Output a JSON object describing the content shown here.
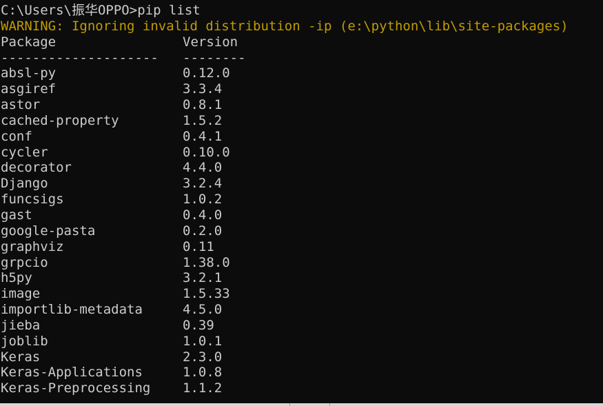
{
  "terminal": {
    "prompt_line": "C:\\Users\\振华OPPO>pip list",
    "prompt_path": "C:\\Users\\",
    "prompt_user_cjk": "振华",
    "prompt_user_rest": "OPPO",
    "prompt_symbol": ">",
    "command": "pip list",
    "warning_line": "WARNING: Ignoring invalid distribution -ip (e:\\python\\lib\\site-packages)",
    "blank_line": "",
    "colors": {
      "background": "#0c0c0c",
      "foreground": "#cccccc",
      "warning": "#c19c00",
      "chrome": "#d6d6d6"
    }
  },
  "table": {
    "headers": {
      "package": "Package",
      "version": "Version"
    },
    "separators": {
      "package": "--------------------",
      "version": "--------"
    },
    "rows": [
      {
        "package": "absl-py",
        "version": "0.12.0"
      },
      {
        "package": "asgiref",
        "version": "3.3.4"
      },
      {
        "package": "astor",
        "version": "0.8.1"
      },
      {
        "package": "cached-property",
        "version": "1.5.2"
      },
      {
        "package": "conf",
        "version": "0.4.1"
      },
      {
        "package": "cycler",
        "version": "0.10.0"
      },
      {
        "package": "decorator",
        "version": "4.4.0"
      },
      {
        "package": "Django",
        "version": "3.2.4"
      },
      {
        "package": "funcsigs",
        "version": "1.0.2"
      },
      {
        "package": "gast",
        "version": "0.4.0"
      },
      {
        "package": "google-pasta",
        "version": "0.2.0"
      },
      {
        "package": "graphviz",
        "version": "0.11"
      },
      {
        "package": "grpcio",
        "version": "1.38.0"
      },
      {
        "package": "h5py",
        "version": "3.2.1"
      },
      {
        "package": "image",
        "version": "1.5.33"
      },
      {
        "package": "importlib-metadata",
        "version": "4.5.0"
      },
      {
        "package": "jieba",
        "version": "0.39"
      },
      {
        "package": "joblib",
        "version": "1.0.1"
      },
      {
        "package": "Keras",
        "version": "2.3.0"
      },
      {
        "package": "Keras-Applications",
        "version": "1.0.8"
      },
      {
        "package": "Keras-Preprocessing",
        "version": "1.1.2"
      }
    ]
  }
}
